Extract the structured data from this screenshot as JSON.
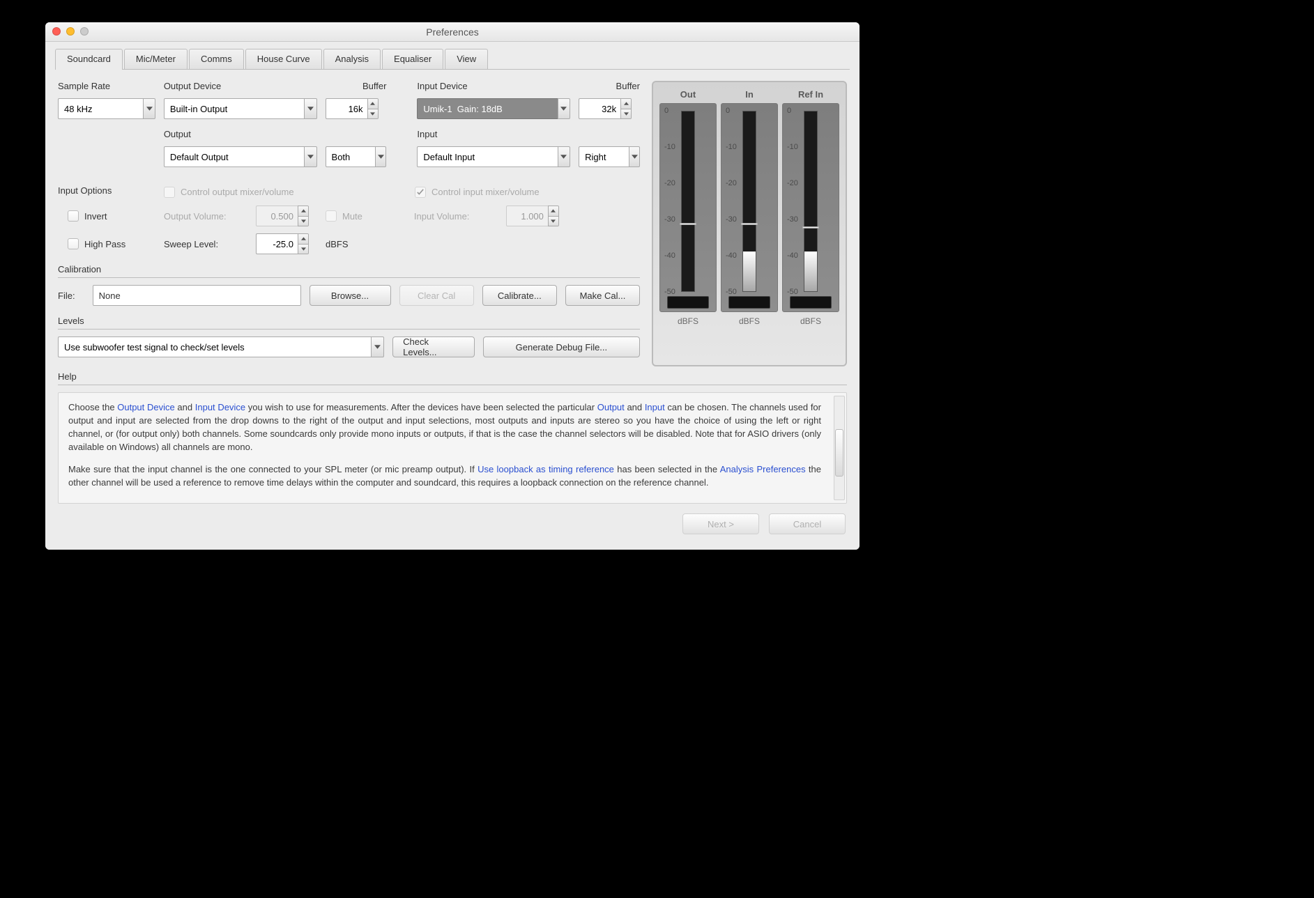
{
  "window": {
    "title": "Preferences"
  },
  "tabs": [
    "Soundcard",
    "Mic/Meter",
    "Comms",
    "House Curve",
    "Analysis",
    "Equaliser",
    "View"
  ],
  "activeTab": 0,
  "labels": {
    "sampleRate": "Sample Rate",
    "outputDevice": "Output Device",
    "bufferOut": "Buffer",
    "inputDevice": "Input Device",
    "bufferIn": "Buffer",
    "output": "Output",
    "input": "Input",
    "inputOptions": "Input Options",
    "invert": "Invert",
    "highPass": "High Pass",
    "controlOutputMixer": "Control output mixer/volume",
    "controlInputMixer": "Control input mixer/volume",
    "outputVolume": "Output Volume:",
    "inputVolume": "Input Volume:",
    "mute": "Mute",
    "sweepLevel": "Sweep Level:",
    "dBFS": "dBFS",
    "calibration": "Calibration",
    "file": "File:",
    "browse": "Browse...",
    "clearCal": "Clear Cal",
    "calibrate": "Calibrate...",
    "makeCal": "Make Cal...",
    "levels": "Levels",
    "checkLevels": "Check Levels...",
    "generateDebug": "Generate Debug File...",
    "help": "Help",
    "next": "Next >",
    "cancel": "Cancel"
  },
  "values": {
    "sampleRate": "48 kHz",
    "outputDevice": "Built-in Output",
    "bufferOut": "16k",
    "inputDevice": "Umik-1  Gain: 18dB",
    "bufferIn": "32k",
    "output": "Default Output",
    "outputChannel": "Both",
    "input": "Default Input",
    "inputChannel": "Right",
    "outputVolume": "0.500",
    "inputVolume": "1.000",
    "sweepLevel": "-25.0",
    "calFile": "None",
    "levelsSignal": "Use subwoofer test signal to check/set levels"
  },
  "meterLabels": {
    "out": "Out",
    "in": "In",
    "ref": "Ref In",
    "unit": "dBFS",
    "ticks": [
      "0",
      "-10",
      "-20",
      "-30",
      "-40",
      "-50"
    ]
  },
  "helpText": {
    "p1a": "Choose the ",
    "link1": "Output Device",
    "p1b": " and ",
    "link2": "Input Device",
    "p1c": " you wish to use for measurements. After the devices have been selected the particular ",
    "link3": "Output",
    "p1d": " and ",
    "link4": "Input",
    "p1e": " can be chosen. The channels used for output and input are selected from the drop downs to the right of the output and input selections, most outputs and inputs are stereo so you have the choice of using the left or right channel, or (for output only) both channels. Some soundcards only provide mono inputs or outputs, if that is the case the channel selectors will be disabled. Note that for ASIO drivers (only available on Windows) all channels are mono.",
    "p2a": "Make sure that the input channel is the one connected to your SPL meter (or mic preamp output). If ",
    "link5": "Use loopback as timing reference",
    "p2b": " has been selected in the ",
    "link6": "Analysis Preferences",
    "p2c": " the other channel will be used a reference to remove time delays within the computer and soundcard, this requires a loopback connection on the reference channel."
  }
}
